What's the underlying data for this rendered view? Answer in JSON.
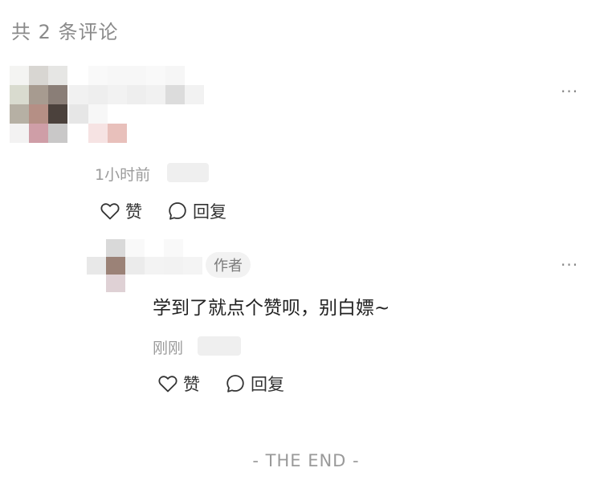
{
  "header": {
    "title": "共 2 条评论"
  },
  "comments": [
    {
      "time": "1小时前",
      "more_label": "···",
      "like_label": "赞",
      "reply_label": "回复"
    }
  ],
  "replies": [
    {
      "badge": "作者",
      "text": "学到了就点个赞呗，别白嫖~",
      "time": "刚刚",
      "more_label": "···",
      "like_label": "赞",
      "reply_label": "回复"
    }
  ],
  "footer": {
    "text": "- THE END -"
  },
  "icons": {
    "like": "heart-outline-icon",
    "reply": "speech-bubble-icon",
    "more": "ellipsis-icon"
  }
}
